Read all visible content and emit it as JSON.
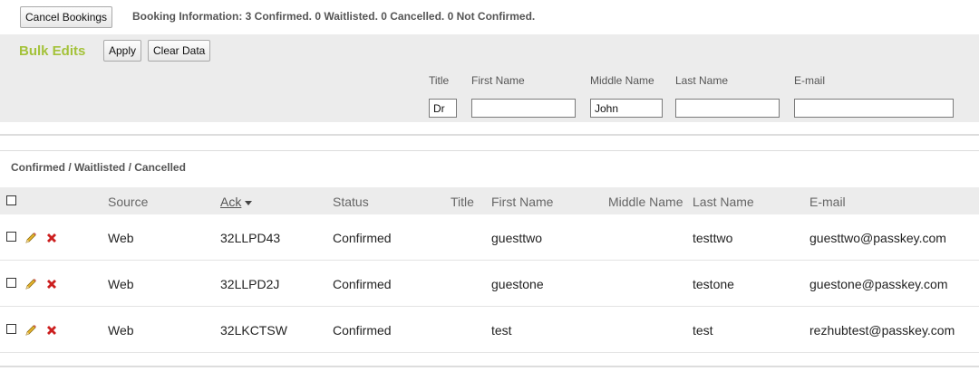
{
  "toolbar": {
    "cancel_bookings_label": "Cancel Bookings",
    "booking_info": "Booking Information: 3 Confirmed. 0 Waitlisted. 0 Cancelled. 0 Not Confirmed."
  },
  "bulk_edits": {
    "title": "Bulk Edits",
    "apply_label": "Apply",
    "clear_label": "Clear Data",
    "fields": {
      "title": {
        "label": "Title",
        "value": "Dr"
      },
      "first_name": {
        "label": "First Name",
        "value": ""
      },
      "middle_name": {
        "label": "Middle Name",
        "value": "John"
      },
      "last_name": {
        "label": "Last Name",
        "value": ""
      },
      "email": {
        "label": "E-mail",
        "value": ""
      }
    }
  },
  "bookings": {
    "section_title": "Confirmed / Waitlisted / Cancelled",
    "columns": {
      "source": "Source",
      "ack": "Ack",
      "status": "Status",
      "title": "Title",
      "first_name": "First Name",
      "middle_name": "Middle Name",
      "last_name": "Last Name",
      "email": "E-mail"
    },
    "rows": [
      {
        "source": "Web",
        "ack": "32LLPD43",
        "status": "Confirmed",
        "title": "",
        "first_name": "guesttwo",
        "middle_name": "",
        "last_name": "testtwo",
        "email": "guesttwo@passkey.com"
      },
      {
        "source": "Web",
        "ack": "32LLPD2J",
        "status": "Confirmed",
        "title": "",
        "first_name": "guestone",
        "middle_name": "",
        "last_name": "testone",
        "email": "guestone@passkey.com"
      },
      {
        "source": "Web",
        "ack": "32LKCTSW",
        "status": "Confirmed",
        "title": "",
        "first_name": "test",
        "middle_name": "",
        "last_name": "test",
        "email": "rezhubtest@passkey.com"
      }
    ]
  },
  "icons": {
    "edit": "pencil-icon",
    "delete": "delete-x-icon"
  },
  "colors": {
    "accent_green": "#a4c23a",
    "delete_red": "#cc1f1f",
    "panel_gray": "#ececec"
  }
}
